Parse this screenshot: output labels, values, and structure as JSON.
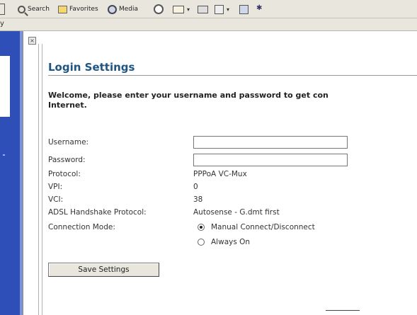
{
  "browser": {
    "toolbar": {
      "search_label": "Search",
      "favorites_label": "Favorites",
      "media_label": "Media"
    },
    "address_bar_glyph": "y"
  },
  "page": {
    "close_glyph": "×",
    "title": "Login Settings",
    "welcome_line1": "Welcome, please enter your username and password to get con",
    "welcome_line2": "Internet.",
    "fields": {
      "username_label": "Username:",
      "username_value": "",
      "password_label": "Password:",
      "password_value": "",
      "protocol_label": "Protocol:",
      "protocol_value": "PPPoA VC-Mux",
      "vpi_label": "VPI:",
      "vpi_value": "0",
      "vci_label": "VCI:",
      "vci_value": "38",
      "adsl_label": "ADSL Handshake Protocol:",
      "adsl_value": "Autosense - G.dmt first",
      "connection_mode_label": "Connection Mode:"
    },
    "connection_modes": [
      {
        "label": "Manual Connect/Disconnect",
        "selected": true
      },
      {
        "label": "Always On",
        "selected": false
      }
    ],
    "save_button_label": "Save Settings"
  }
}
